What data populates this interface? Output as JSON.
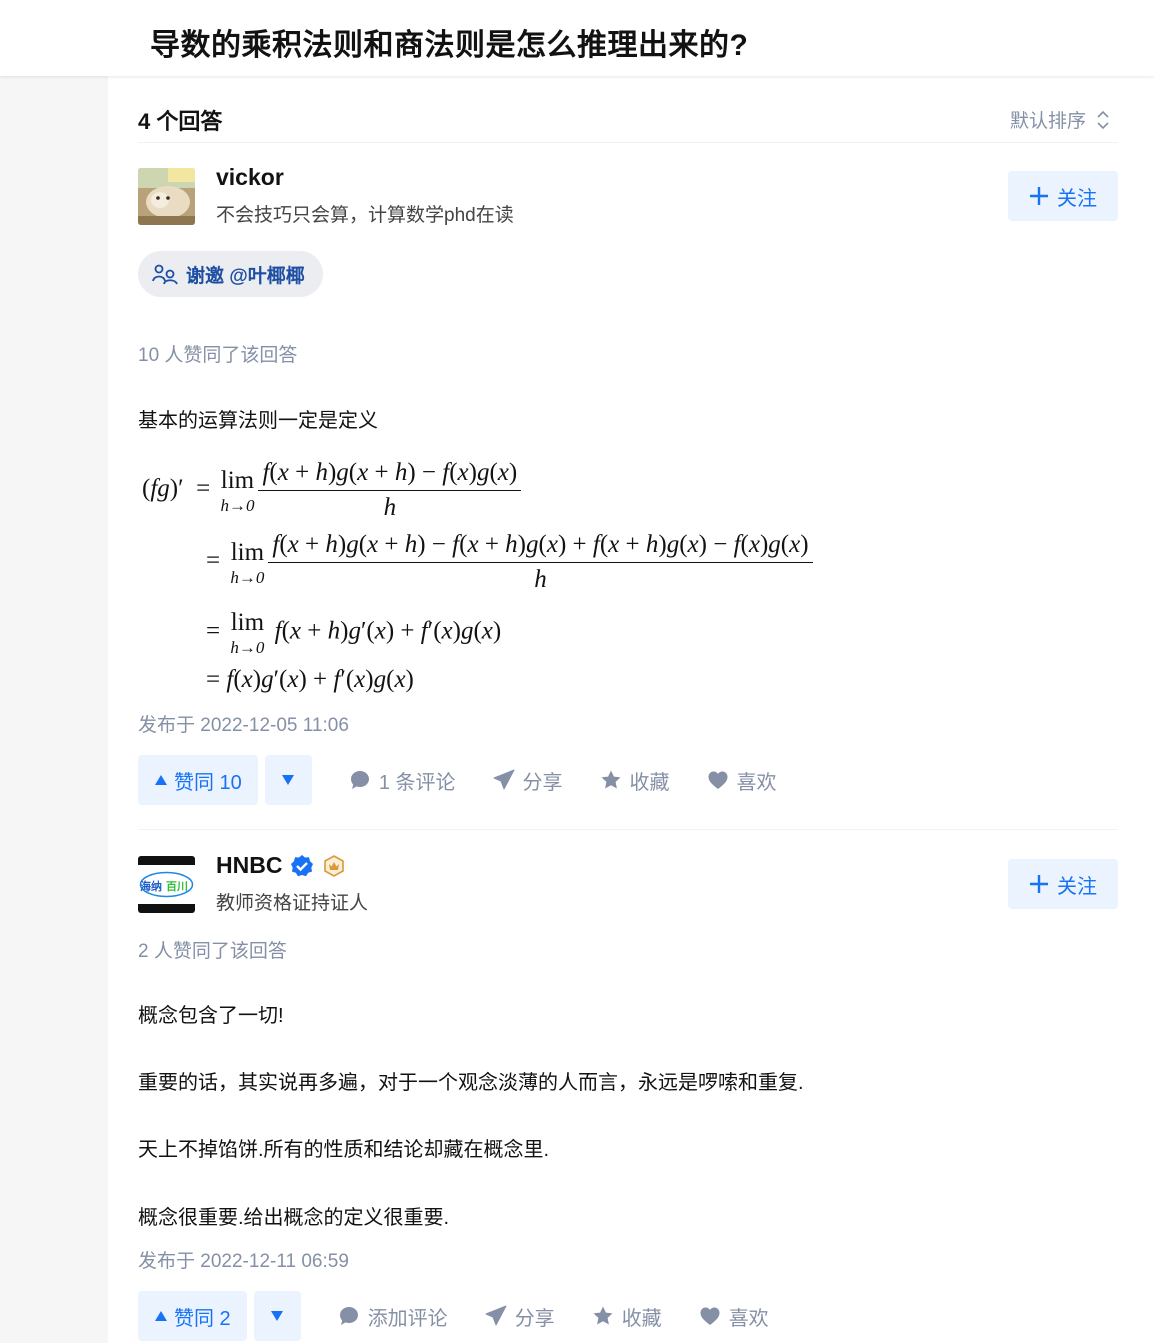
{
  "question": {
    "title": "导数的乘积法则和商法则是怎么推理出来的?"
  },
  "answers_header": {
    "count_label": "4 个回答",
    "sort_label": "默认排序"
  },
  "answers": [
    {
      "author": {
        "name": "vickor",
        "bio": "不会技巧只会算，计算数学phd在读",
        "follow_label": "关注"
      },
      "invite_label": "谢邀 @叶椰椰",
      "upvote_meta": "10 人赞同了该回答",
      "paragraphs": [
        "基本的运算法则一定是定义"
      ],
      "math_lines": [
        "(fg)′ = lim_{h→0} [f(x+h)g(x+h) − f(x)g(x)] / h",
        "= lim_{h→0} [f(x+h)g(x+h) − f(x+h)g(x) + f(x+h)g(x) − f(x)g(x)] / h",
        "= lim_{h→0} f(x+h)g′(x) + f′(x)g(x)",
        "= f(x)g′(x) + f′(x)g(x)"
      ],
      "date": "发布于 2022-12-05 11:06",
      "actions": {
        "vote_up": "赞同 10",
        "comment": "1 条评论",
        "share": "分享",
        "collect": "收藏",
        "like": "喜欢"
      }
    },
    {
      "author": {
        "name": "HNBC",
        "bio": "教师资格证持证人",
        "follow_label": "关注",
        "avatar_text": "海纳百川"
      },
      "upvote_meta": "2 人赞同了该回答",
      "paragraphs": [
        "概念包含了一切!",
        "重要的话，其实说再多遍，对于一个观念淡薄的人而言，永远是啰嗦和重复.",
        "天上不掉馅饼.所有的性质和结论却藏在概念里.",
        "概念很重要.给出概念的定义很重要."
      ],
      "date": "发布于 2022-12-11 06:59",
      "actions": {
        "vote_up": "赞同 2",
        "comment": "添加评论",
        "share": "分享",
        "collect": "收藏",
        "like": "喜欢"
      }
    }
  ],
  "colors": {
    "brand": "#1772f6",
    "muted": "#8590a6",
    "chip_bg": "#ebf3ff"
  }
}
